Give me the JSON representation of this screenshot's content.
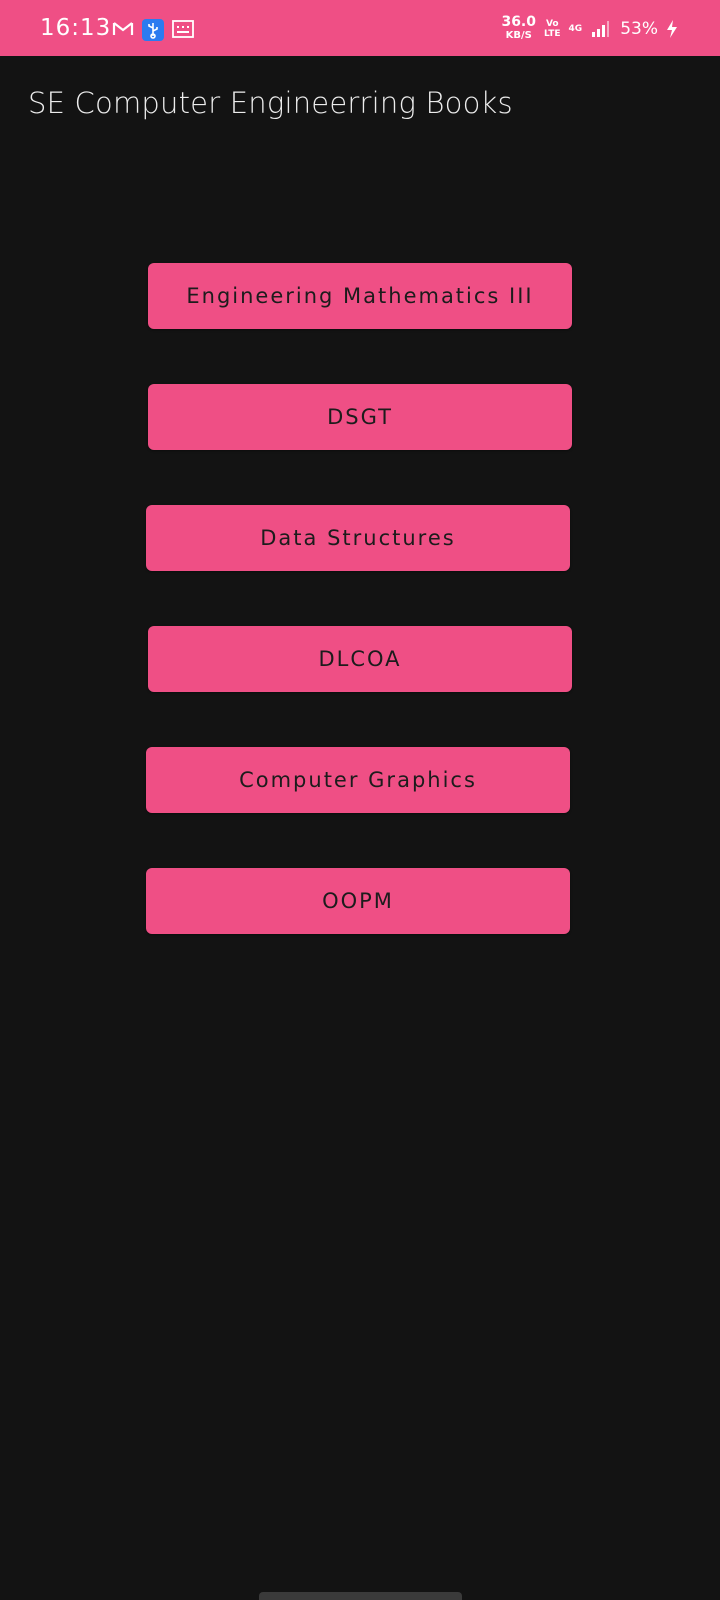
{
  "status_bar": {
    "time": "16:13",
    "net_speed_value": "36.0",
    "net_speed_unit": "KB/S",
    "volte_top": "Vo",
    "volte_bottom": "LTE",
    "network_type": "4G",
    "battery": "53%",
    "icons_left": [
      "gmail-icon",
      "usb-icon",
      "keyboard-icon"
    ],
    "icons_right": [
      "signal-icon",
      "charging-icon"
    ]
  },
  "app": {
    "title": "SE Computer Engineerring Books"
  },
  "books": [
    {
      "label": "Engineering Mathematics III"
    },
    {
      "label": "DSGT"
    },
    {
      "label": "Data Structures"
    },
    {
      "label": "DLCOA"
    },
    {
      "label": "Computer Graphics"
    },
    {
      "label": "OOPM"
    }
  ],
  "colors": {
    "accent": "#ef4f85",
    "background": "#131313",
    "title_text": "#ececec",
    "button_text": "#1c1c1c"
  }
}
